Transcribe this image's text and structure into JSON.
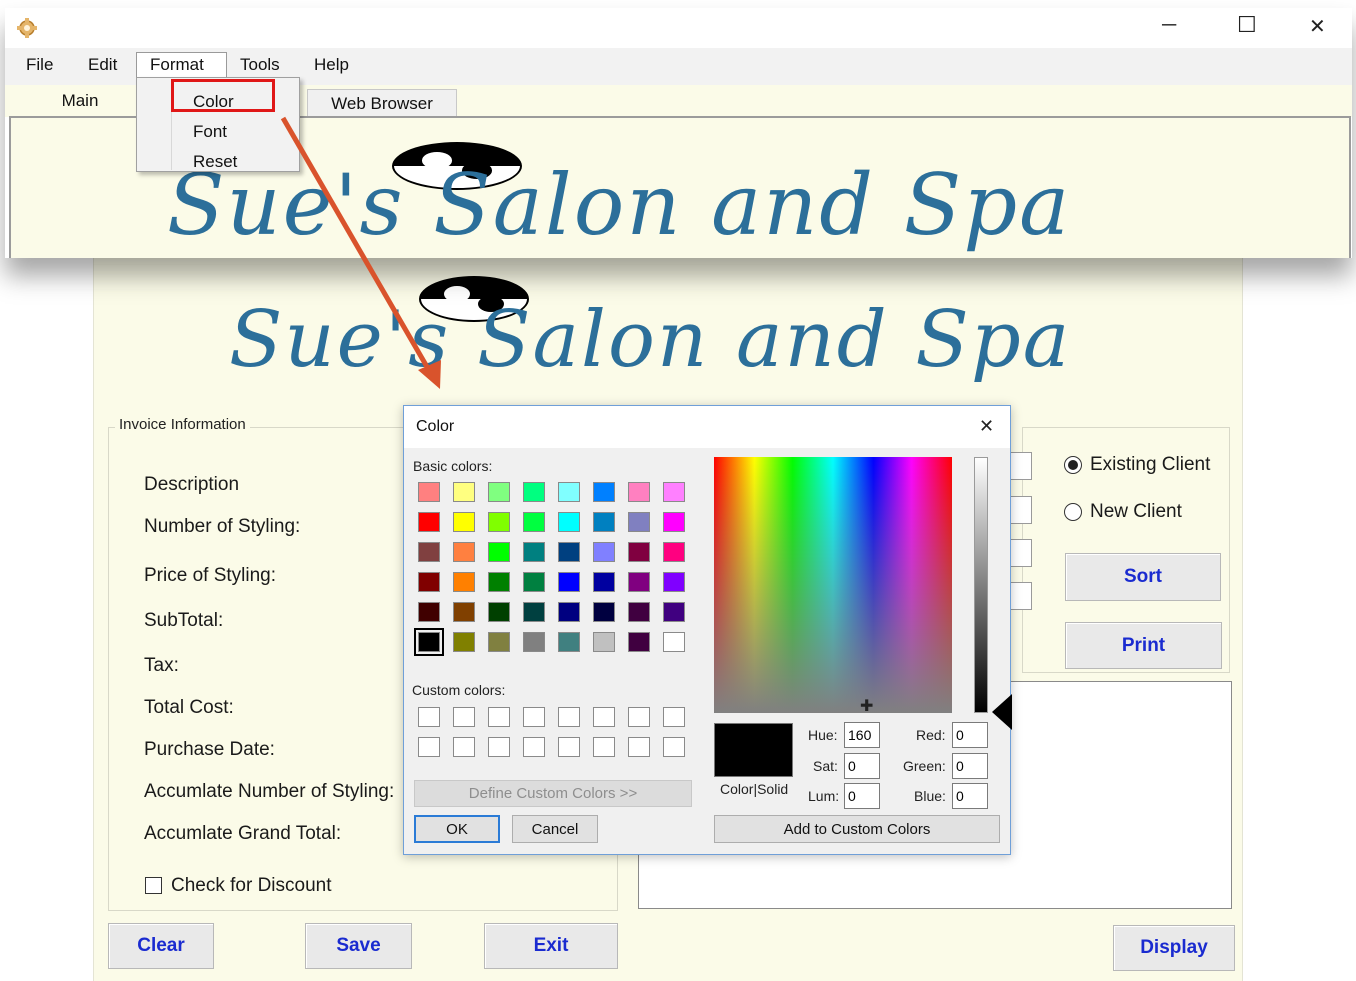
{
  "app": {
    "window_controls": {
      "minimize": "─",
      "maximize": "☐",
      "close": "✕"
    },
    "menu": [
      "File",
      "Edit",
      "Format",
      "Tools",
      "Help"
    ],
    "format_menu": [
      "Color",
      "Font",
      "Reset"
    ],
    "tabs": [
      "Main",
      "Web Browser"
    ],
    "banner_title": "Sue's Salon and Spa"
  },
  "form": {
    "banner_title": "Sue's Salon and Spa",
    "invoice_group_title": "Invoice Information",
    "labels": [
      "Description",
      "Number of Styling:",
      "Price of Styling:",
      "SubTotal:",
      "Tax:",
      "Total Cost:",
      "Purchase Date:",
      "Accumlate Number of Styling:",
      "Accumlate Grand Total:"
    ],
    "discount_checkbox": "Check for Discount",
    "radios": {
      "existing": "Existing Client",
      "new": "New Client"
    },
    "buttons": {
      "sort": "Sort",
      "print": "Print",
      "clear": "Clear",
      "save": "Save",
      "exit": "Exit",
      "display": "Display"
    }
  },
  "color_dialog": {
    "title": "Color",
    "close": "✕",
    "basic_colors_label": "Basic colors:",
    "custom_colors_label": "Custom colors:",
    "define_button": "Define Custom Colors >>",
    "ok": "OK",
    "cancel": "Cancel",
    "add_button": "Add to Custom Colors",
    "color_solid_label": "Color|Solid",
    "hue_label": "Hue:",
    "hue": "160",
    "sat_label": "Sat:",
    "sat": "0",
    "lum_label": "Lum:",
    "lum": "0",
    "red_label": "Red:",
    "red": "0",
    "green_label": "Green:",
    "green": "0",
    "blue_label": "Blue:",
    "blue": "0",
    "basic_colors": [
      [
        "#ff8080",
        "#ffff80",
        "#80ff80",
        "#00ff80",
        "#80ffff",
        "#0080ff",
        "#ff80c0",
        "#ff80ff"
      ],
      [
        "#ff0000",
        "#ffff00",
        "#80ff00",
        "#00ff40",
        "#00ffff",
        "#0080c0",
        "#8080c0",
        "#ff00ff"
      ],
      [
        "#804040",
        "#ff8040",
        "#00ff00",
        "#008080",
        "#004080",
        "#8080ff",
        "#800040",
        "#ff0080"
      ],
      [
        "#800000",
        "#ff8000",
        "#008000",
        "#008040",
        "#0000ff",
        "#0000a0",
        "#800080",
        "#8000ff"
      ],
      [
        "#400000",
        "#804000",
        "#004000",
        "#004040",
        "#000080",
        "#000040",
        "#400040",
        "#400080"
      ],
      [
        "#000000",
        "#808000",
        "#808040",
        "#808080",
        "#408080",
        "#c0c0c0",
        "#400040",
        "#ffffff"
      ]
    ],
    "selected_color": "#000000"
  },
  "annotation": {
    "highlight_color": "#e01717",
    "arrow_color": "#d9532c"
  }
}
